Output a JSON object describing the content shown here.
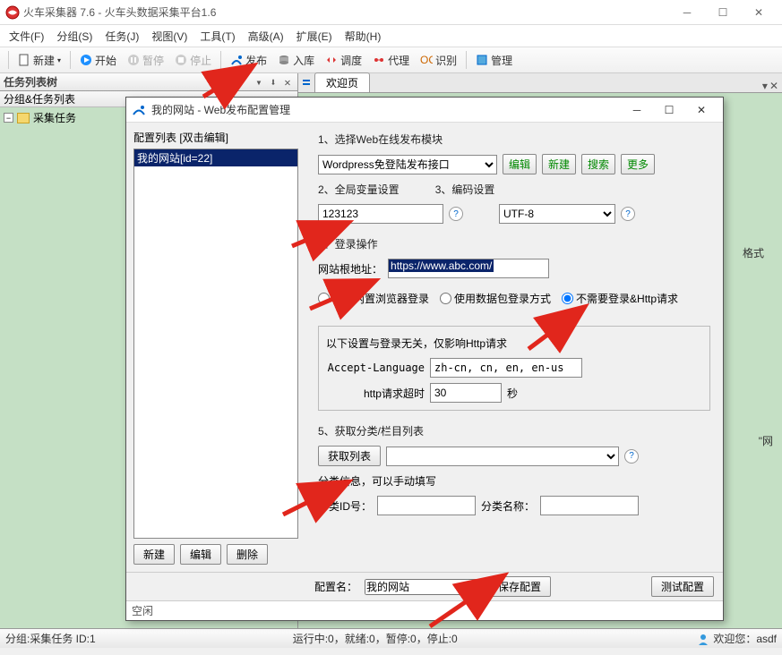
{
  "window": {
    "title": "火车采集器 7.6 - 火车头数据采集平台1.6"
  },
  "menu": [
    "文件(F)",
    "分组(S)",
    "任务(J)",
    "视图(V)",
    "工具(T)",
    "高级(A)",
    "扩展(E)",
    "帮助(H)"
  ],
  "toolbar": {
    "new": "新建",
    "start": "开始",
    "pause": "暂停",
    "stop": "停止",
    "publish": "发布",
    "store": "入库",
    "schedule": "调度",
    "proxy": "代理",
    "recognize": "识别",
    "manage": "管理"
  },
  "left": {
    "panelTitle": "任务列表树",
    "subTitle": "分组&任务列表",
    "treeItem": "采集任务"
  },
  "tabs": {
    "welcome": "欢迎页"
  },
  "bg": {
    "t1": "格式",
    "t2": "\"网"
  },
  "dialog": {
    "title": "我的网站 - Web发布配置管理",
    "configList": "配置列表    [双击编辑]",
    "listItem": "我的网站[id=22]",
    "s1": "1、选择Web在线发布模块",
    "moduleSel": "Wordpress免登陆发布接口",
    "edit": "编辑",
    "new": "新建",
    "search": "搜索",
    "more": "更多",
    "s2": "2、全局变量设置",
    "globalVar": "123123",
    "s3": "3、编码设置",
    "encoding": "UTF-8",
    "s4": "4、登录操作",
    "rootLbl": "网站根地址：",
    "rootUrl": "https://www.abc.com/",
    "r1": "使用内置浏览器登录",
    "r2": "使用数据包登录方式",
    "r3": "不需要登录&Http请求",
    "httpNote": "以下设置与登录无关，仅影响Http请求",
    "acceptLang": "Accept-Language",
    "acceptLangVal": "zh-cn, cn, en, en-us",
    "timeout": "http请求超时",
    "timeoutVal": "30",
    "timeoutUnit": "秒",
    "s5": "5、获取分类/栏目列表",
    "getList": "获取列表",
    "catInfo": "分类信息，可以手动填写",
    "catId": "分类ID号：",
    "catName": "分类名称：",
    "leftNew": "新建",
    "leftEdit": "编辑",
    "leftDel": "删除",
    "cfgName": "配置名：",
    "cfgNameVal": "我的网站",
    "save": "保存配置",
    "test": "测试配置",
    "idle": "空闲"
  },
  "status": {
    "group": "分组:采集任务  ID:1",
    "run": "运行中:0，就绪:0，暂停:0，停止:0",
    "welcome": "欢迎您：asdf"
  }
}
